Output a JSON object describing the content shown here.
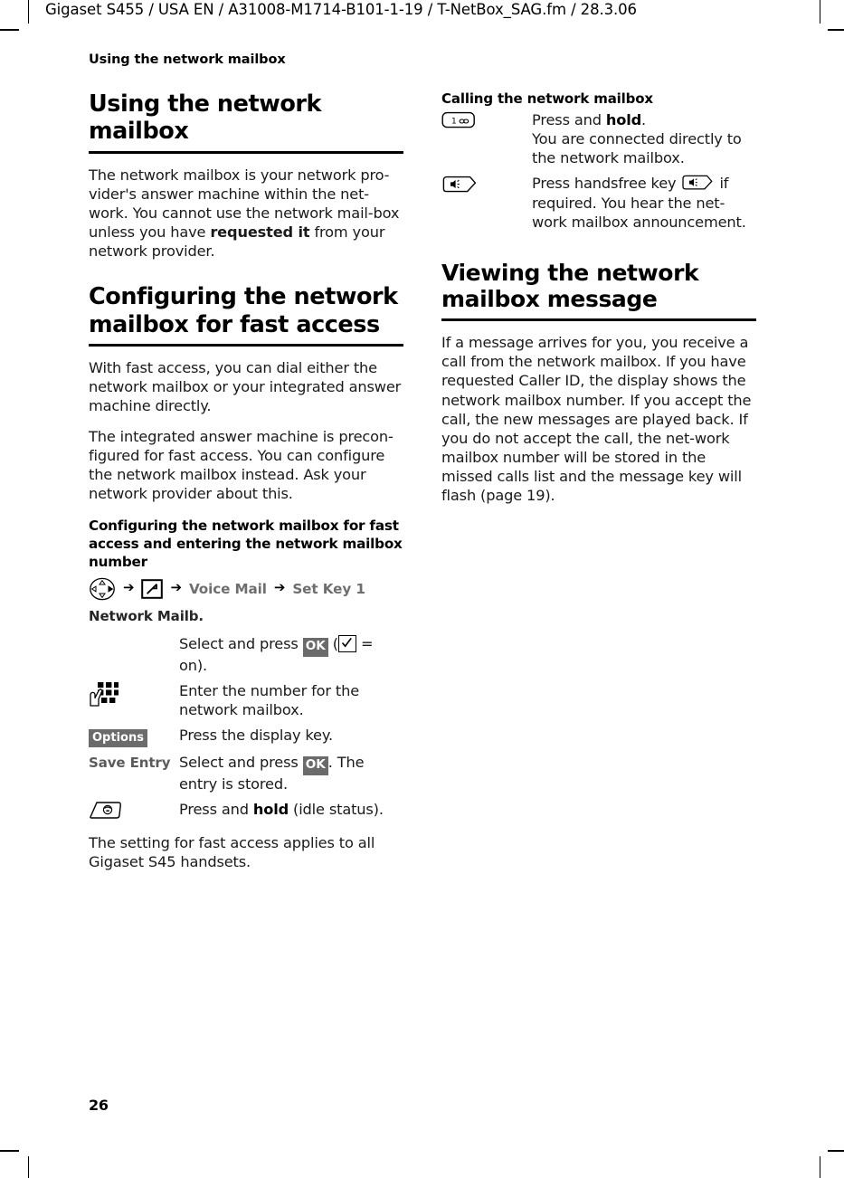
{
  "header": {
    "running_head": "Gigaset S455 / USA EN / A31008-M1714-B101-1-19  / T-NetBox_SAG.fm / 28.3.06",
    "topic": "Using the network mailbox"
  },
  "page": {
    "number": "26"
  },
  "left_column": {
    "section_title": "Using the network mailbox",
    "intro_paragraph_1": "The network mailbox is your network pro-vider's answer machine within the net-work. You cannot use the network mail-box unless you have ",
    "intro_bold": "requested it",
    "intro_paragraph_1_tail": " from your network provider.",
    "section2_title": "Configuring the network mailbox for fast access",
    "section2_paragraph_1": "With fast access, you can dial either the network mailbox or your integrated answer machine directly.",
    "section2_paragraph_2": "The integrated answer machine is precon-figured for fast access. You can configure the network mailbox instead. Ask your network provider about this.",
    "subsection_title": "Configuring the network mailbox for fast access and entering the network mailbox number",
    "menu_path": {
      "nav_icon": "navigation-control-key-icon",
      "arrow": "➔",
      "menu_icon": "settings-menu-key-icon",
      "item1": "Voice Mail",
      "item2": "Set Key 1"
    },
    "procedure": [
      {
        "key_label": "Network Mailb.",
        "key_type": "label-dark",
        "desc_pre": "Select and press ",
        "chip": "OK",
        "desc_mid": " (",
        "has_checkbox": true,
        "desc_post": " = on)."
      },
      {
        "key_label": "",
        "key_type": "keypad-icon",
        "desc_pre": "Enter the number for the network mailbox.",
        "chip": "",
        "desc_mid": "",
        "has_checkbox": false,
        "desc_post": ""
      },
      {
        "key_label": "Options",
        "key_type": "chip",
        "desc_pre": "Press the display key.",
        "chip": "",
        "desc_mid": "",
        "has_checkbox": false,
        "desc_post": ""
      },
      {
        "key_label": "Save Entry",
        "key_type": "label-grey",
        "desc_pre": "Select and press ",
        "chip": "OK",
        "desc_mid": ". The entry is stored.",
        "has_checkbox": false,
        "desc_post": ""
      },
      {
        "key_label": "",
        "key_type": "endkey-icon",
        "desc_pre": "Press and ",
        "chip": "",
        "desc_bold": "hold",
        "desc_mid": " (idle status).",
        "has_checkbox": false,
        "desc_post": ""
      }
    ],
    "closing_paragraph": "The setting for fast access applies to all Gigaset S45 handsets."
  },
  "right_column": {
    "subsection_title": "Calling the network mailbox",
    "procedure": [
      {
        "key_type": "one-key-icon",
        "key_digit": "1",
        "key_symbol": "∞",
        "desc_pre": "Press and ",
        "desc_bold": "hold",
        "desc_post": ".\nYou are connected directly to the network mailbox."
      },
      {
        "key_type": "handsfree-key-icon",
        "desc_pre": "Press handsfree key ",
        "desc_post": " if required. You hear the net-work mailbox announcement."
      }
    ],
    "section_title": "Viewing the network mailbox message",
    "paragraph": "If a message arrives for you, you receive a call from the network mailbox. If you have requested Caller ID, the display shows the network mailbox number. If you accept the call, the new messages are played back. If you do not accept the call, the net-work mailbox number will be stored in the missed calls list and the message key will flash (page 19)."
  },
  "colors": {
    "text": "#1a1a1a",
    "heading": "#000000",
    "chip_background": "#6b6b6b",
    "chip_text": "#ffffff",
    "menu_path_text": "#6e6e6e",
    "softkey_grey": "#5b5b5b"
  }
}
